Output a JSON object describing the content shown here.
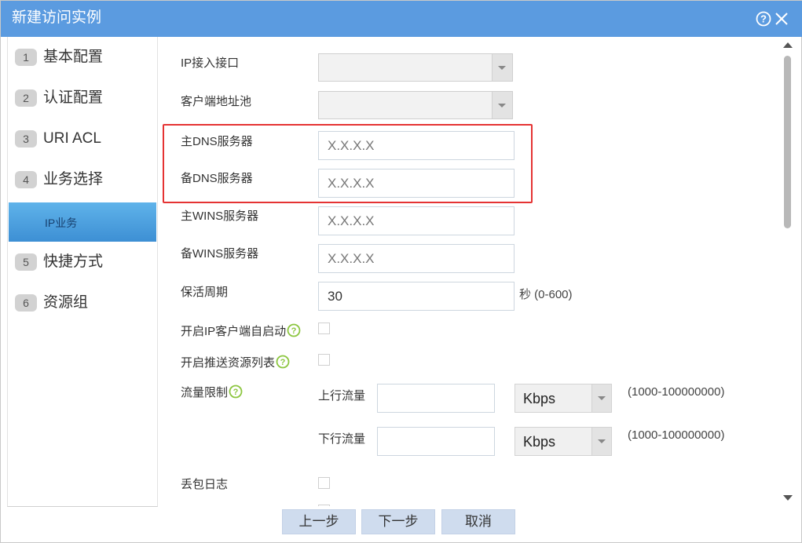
{
  "dialog": {
    "title": "新建访问实例",
    "help_icon": "question-circle-icon",
    "close_icon": "close-icon"
  },
  "sidebar": {
    "steps": [
      {
        "num": "1",
        "label": "基本配置"
      },
      {
        "num": "2",
        "label": "认证配置"
      },
      {
        "num": "3",
        "label": "URI ACL"
      },
      {
        "num": "4",
        "label": "业务选择"
      },
      {
        "num": "5",
        "label": "快捷方式"
      },
      {
        "num": "6",
        "label": "资源组"
      }
    ],
    "active_sub": "IP业务"
  },
  "form": {
    "ip_interface": {
      "label": "IP接入接口",
      "value": ""
    },
    "client_pool": {
      "label": "客户端地址池",
      "value": ""
    },
    "primary_dns": {
      "label": "主DNS服务器",
      "placeholder": "X.X.X.X"
    },
    "secondary_dns": {
      "label": "备DNS服务器",
      "placeholder": "X.X.X.X"
    },
    "primary_wins": {
      "label": "主WINS服务器",
      "placeholder": "X.X.X.X"
    },
    "secondary_wins": {
      "label": "备WINS服务器",
      "placeholder": "X.X.X.X"
    },
    "keepalive": {
      "label": "保活周期",
      "value": "30",
      "hint": "秒 (0-600)"
    },
    "auto_start": {
      "label": "开启IP客户端自启动",
      "checked": false
    },
    "push_resources": {
      "label": "开启推送资源列表",
      "checked": false
    },
    "rate_limit": {
      "label": "流量限制",
      "upstream": {
        "label": "上行流量",
        "value": "",
        "unit": "Kbps",
        "hint": "(1000-100000000)"
      },
      "downstream": {
        "label": "下行流量",
        "value": "",
        "unit": "Kbps",
        "hint": "(1000-100000000)"
      }
    },
    "drop_log": {
      "label": "丢包日志",
      "checked": false
    }
  },
  "footer": {
    "prev": "上一步",
    "next": "下一步",
    "cancel": "取消"
  },
  "colors": {
    "titlebar": "#5b9be0",
    "highlight": "#e53333",
    "help_icon": "#8cc63f",
    "button": "#cfdcee"
  }
}
